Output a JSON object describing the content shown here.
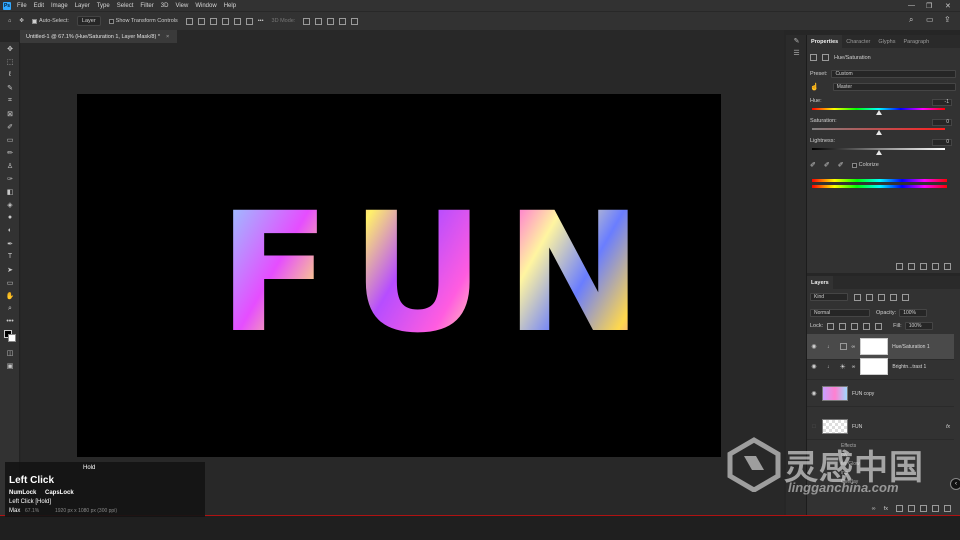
{
  "menubar": {
    "logo": "Ps",
    "items": [
      "File",
      "Edit",
      "Image",
      "Layer",
      "Type",
      "Select",
      "Filter",
      "3D",
      "View",
      "Window",
      "Help"
    ],
    "window_controls": [
      "—",
      "❐",
      "✕"
    ]
  },
  "options": {
    "auto_select_label": "Auto-Select:",
    "auto_select_value": "Layer",
    "show_transform_label": "Show Transform Controls",
    "more_label": "•••",
    "mode_3d_label": "3D Mode:"
  },
  "document": {
    "tab_title": "Untitled-1 @ 67.1% (Hue/Saturation 1, Layer Mask/8) *",
    "close": "×",
    "canvas_text": "FUN"
  },
  "properties": {
    "tabs": [
      "Properties",
      "Character",
      "Glyphs",
      "Paragraph"
    ],
    "adjustment_title": "Hue/Saturation",
    "preset_label": "Preset:",
    "preset_value": "Custom",
    "channel_value": "Master",
    "hue_label": "Hue:",
    "hue_value": "-1",
    "saturation_label": "Saturation:",
    "saturation_value": "0",
    "lightness_label": "Lightness:",
    "lightness_value": "0",
    "colorize_label": "Colorize"
  },
  "layers": {
    "tab": "Layers",
    "kind_label": "Kind",
    "blend_mode": "Normal",
    "opacity_label": "Opacity:",
    "opacity_value": "100%",
    "lock_label": "Lock:",
    "fill_label": "Fill:",
    "fill_value": "100%",
    "items": [
      {
        "name": "Hue/Saturation 1",
        "selected": true
      },
      {
        "name": "Brightn...trast 1",
        "selected": false
      },
      {
        "name": "FUN copy",
        "selected": false
      },
      {
        "name": "FUN",
        "selected": false
      }
    ],
    "effects_partial": [
      "Effects",
      "ow",
      "ter Glow",
      "ing",
      "Overlay"
    ]
  },
  "key_overlay": {
    "hold": "Hold",
    "click": "Left Click",
    "numlock": "NumLock",
    "capslock": "CapsLock",
    "detail": "Left Click [Hold]",
    "max": "Max",
    "zoom": "67.1%",
    "doc_size": "1920 px x 1080 px (300 ppi)"
  },
  "watermark": {
    "cn": "灵感中国",
    "url": "lingganchina.com"
  },
  "colors": {
    "app_bg": "#262626",
    "panel_bg": "#323232",
    "accent": "#31a8ff"
  }
}
